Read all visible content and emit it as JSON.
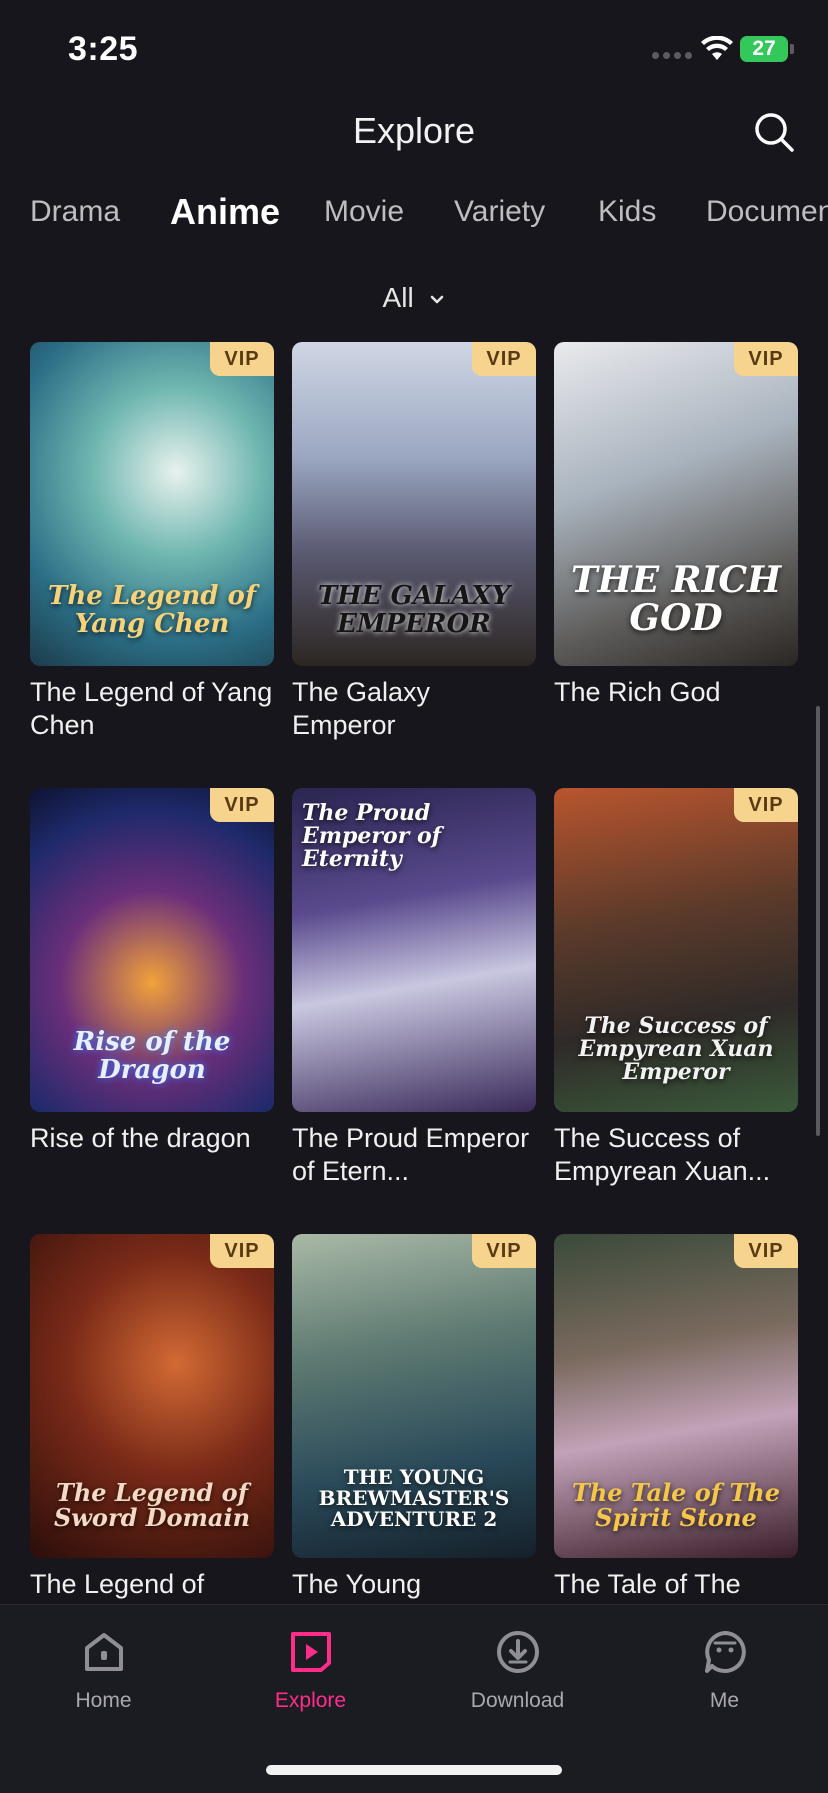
{
  "status_bar": {
    "time": "3:25",
    "battery": "27"
  },
  "header": {
    "title": "Explore"
  },
  "tabs": [
    "Drama",
    "Anime",
    "Movie",
    "Variety",
    "Kids",
    "Documentary"
  ],
  "active_tab": "Anime",
  "filter": {
    "label": "All"
  },
  "cards": [
    {
      "poster_text": "The Legend of Yang Chen",
      "title": "The Legend of Yang Chen",
      "vip": "VIP"
    },
    {
      "poster_text": "THE GALAXY EMPEROR",
      "title": "The Galaxy Emperor",
      "vip": "VIP"
    },
    {
      "poster_text": "THE RICH GOD",
      "title": "The Rich God",
      "vip": "VIP"
    },
    {
      "poster_text": "Rise of the Dragon",
      "title": "Rise of the dragon",
      "vip": "VIP"
    },
    {
      "poster_text": "The Proud Emperor of Eternity",
      "title": "The Proud Emperor of Etern...",
      "vip": ""
    },
    {
      "poster_text": "The Success of Empyrean Xuan Emperor",
      "title": "The Success of Empyrean Xuan...",
      "vip": "VIP"
    },
    {
      "poster_text": "The Legend of Sword Domain",
      "title": "The Legend of",
      "vip": "VIP"
    },
    {
      "poster_text": "THE YOUNG BREWMASTER'S ADVENTURE 2",
      "title": "The Young",
      "vip": "VIP"
    },
    {
      "poster_text": "The Tale of The Spirit Stone",
      "title": "The Tale of The",
      "vip": "VIP"
    }
  ],
  "bottom_nav": [
    {
      "label": "Home",
      "icon": "home-icon"
    },
    {
      "label": "Explore",
      "icon": "explore-icon"
    },
    {
      "label": "Download",
      "icon": "download-icon"
    },
    {
      "label": "Me",
      "icon": "me-icon"
    }
  ],
  "colors": {
    "accent": "#ff2d8a",
    "vip_badge": "#f7d48e",
    "background": "#16161c"
  }
}
